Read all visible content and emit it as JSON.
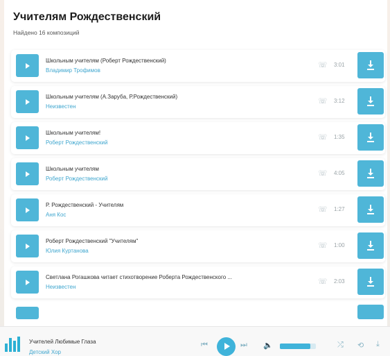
{
  "header": {
    "title": "Учителям Рождественский",
    "subtitle": "Найдено 16 композиций"
  },
  "tracks": [
    {
      "title": "Школьным учителям (Роберт Рождественский)",
      "artist": "Владимир Трофимов",
      "duration": "3:01"
    },
    {
      "title": "Школьным учителям (А.Зарубa, Р.Рождественский)",
      "artist": "Неизвестен",
      "duration": "3:12"
    },
    {
      "title": "Школьным учителям!",
      "artist": "Роберт Рождественский",
      "duration": "1:35"
    },
    {
      "title": "Школьным учителям",
      "artist": "Роберт Рождественский",
      "duration": "4:05"
    },
    {
      "title": "Р. Рождественский - Учителям",
      "artist": "Аня Кос",
      "duration": "1:27"
    },
    {
      "title": "Роберт Рождественский \"Учителям\"",
      "artist": "Юлия Куртанова",
      "duration": "1:00"
    },
    {
      "title": "Светлана Рогашкова читает стихотворение Роберта Рождественского ...",
      "artist": "Неизвестен",
      "duration": "2:03"
    }
  ],
  "icons": {
    "play": "play-icon",
    "phone": "phone-icon",
    "download": "download-icon"
  },
  "player": {
    "title": "Учителей Любимые Глаза",
    "artist": "Детский Хор",
    "volume": 0.85
  },
  "colors": {
    "accent": "#4fb6d8",
    "link": "#41a7cf"
  }
}
